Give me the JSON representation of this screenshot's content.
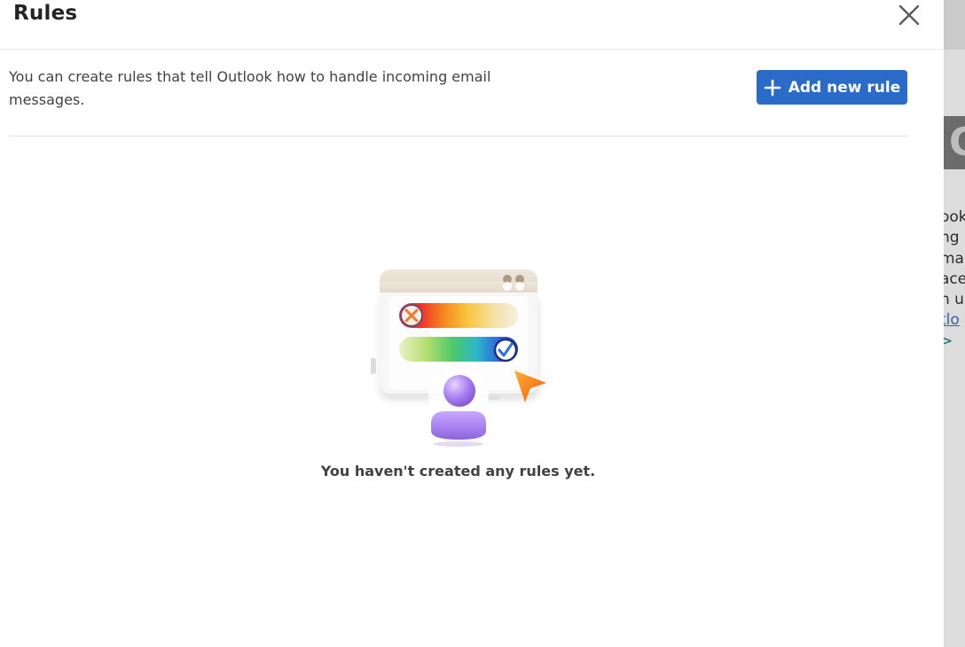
{
  "dialog": {
    "title": "Rules",
    "description": "You can create rules that tell Outlook how to handle incoming email messages.",
    "add_button_label": "Add new rule",
    "empty_state_text": "You haven't created any rules yet."
  },
  "icons": {
    "close": "close-icon",
    "add": "plus-icon",
    "illustration": "rules-empty-illustration"
  },
  "colors": {
    "accent": "#2a6bc9",
    "title_text": "#242424",
    "body_text": "#424242"
  }
}
